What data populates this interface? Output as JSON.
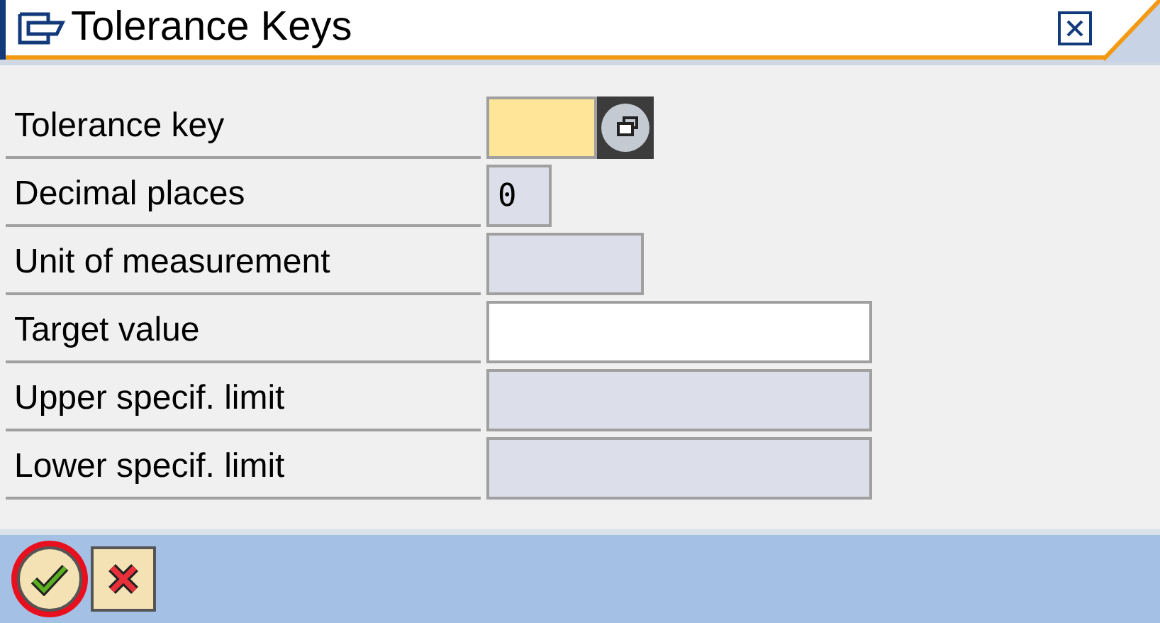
{
  "window": {
    "title": "Tolerance Keys"
  },
  "fields": [
    {
      "label": "Tolerance key",
      "kind": "required",
      "has_help": true
    },
    {
      "label": "Decimal places",
      "kind": "display",
      "value": "0",
      "has_help": false
    },
    {
      "label": "Unit of measurement",
      "kind": "display",
      "has_help": false
    },
    {
      "label": "Target value",
      "kind": "input",
      "has_help": false
    },
    {
      "label": "Upper specif. limit",
      "kind": "display",
      "has_help": false
    },
    {
      "label": "Lower specif. limit",
      "kind": "display",
      "has_help": false
    }
  ],
  "buttons": [
    {
      "kind": "confirm",
      "highlighted": true
    },
    {
      "kind": "cancel",
      "highlighted": false
    }
  ]
}
